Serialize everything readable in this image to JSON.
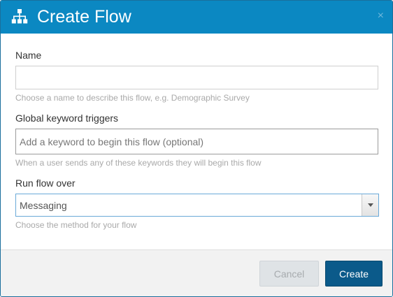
{
  "dialog": {
    "title": "Create Flow",
    "close_glyph": "×",
    "icon": "sitemap-icon"
  },
  "fields": {
    "name": {
      "label": "Name",
      "value": "",
      "help": "Choose a name to describe this flow, e.g. Demographic Survey"
    },
    "keywords": {
      "label": "Global keyword triggers",
      "placeholder": "Add a keyword to begin this flow (optional)",
      "help": "When a user sends any of these keywords they will begin this flow"
    },
    "run_over": {
      "label": "Run flow over",
      "selected": "Messaging",
      "help": "Choose the method for your flow"
    }
  },
  "buttons": {
    "cancel": "Cancel",
    "create": "Create"
  },
  "colors": {
    "header": "#0b88c2",
    "primary_button": "#0b5a8a",
    "cancel_button": "#dfe3e6"
  }
}
